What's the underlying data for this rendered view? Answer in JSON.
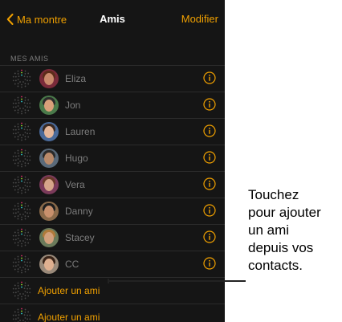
{
  "navbar": {
    "back_label": "Ma montre",
    "title": "Amis",
    "edit_label": "Modifier"
  },
  "section_header": "MES AMIS",
  "friends": [
    {
      "name": "Eliza",
      "skin": "#c98a6c",
      "hair": "#5b2c1a",
      "bg": "#7a2a3a"
    },
    {
      "name": "Jon",
      "skin": "#d9a07a",
      "hair": "#2b2b2b",
      "bg": "#4a7a4a"
    },
    {
      "name": "Lauren",
      "skin": "#e6b79a",
      "hair": "#3b2a22",
      "bg": "#4a6a9a"
    },
    {
      "name": "Hugo",
      "skin": "#b98a6a",
      "hair": "#2a2a2a",
      "bg": "#5a6a7a"
    },
    {
      "name": "Vera",
      "skin": "#d6a58a",
      "hair": "#6a3a2a",
      "bg": "#7a3a5a"
    },
    {
      "name": "Danny",
      "skin": "#c8906c",
      "hair": "#1e1e1e",
      "bg": "#8a6a4a"
    },
    {
      "name": "Stacey",
      "skin": "#d2a07c",
      "hair": "#b07a3a",
      "bg": "#6a7a5a"
    },
    {
      "name": "CC",
      "skin": "#e0b090",
      "hair": "#3a2418",
      "bg": "#9a8a7a"
    }
  ],
  "add_rows": [
    {
      "label": "Ajouter un ami"
    },
    {
      "label": "Ajouter un ami"
    }
  ],
  "callout": {
    "lines": [
      "Touchez",
      "pour ajouter",
      "un ami",
      "depuis vos",
      "contacts."
    ]
  },
  "icons": {
    "back": "chevron-left-icon",
    "ring": "activity-ring-icon",
    "info": "info-icon"
  },
  "colors": {
    "accent": "#f0a000",
    "background": "#151515",
    "name_text": "#7c7c7c",
    "ring_red": "#e0306a",
    "ring_green": "#9be22d",
    "ring_blue": "#2fd3d8"
  }
}
